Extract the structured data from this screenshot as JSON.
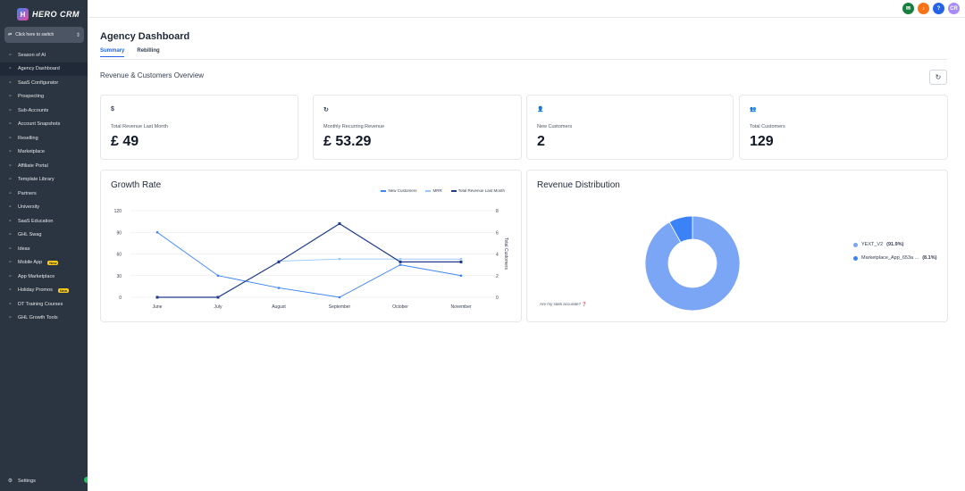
{
  "app": {
    "logo_text": "HERO CRM",
    "switcher_label": "Click here to switch"
  },
  "sidebar": {
    "items": [
      {
        "label": "Season of AI",
        "icon": "sparkle-icon"
      },
      {
        "label": "Agency Dashboard",
        "icon": "dashboard-icon",
        "active": true
      },
      {
        "label": "SaaS Configurator",
        "icon": "sliders-icon"
      },
      {
        "label": "Prospecting",
        "icon": "target-icon"
      },
      {
        "label": "Sub-Accounts",
        "icon": "users-icon"
      },
      {
        "label": "Account Snapshots",
        "icon": "camera-icon"
      },
      {
        "label": "Reselling",
        "icon": "cart-icon"
      },
      {
        "label": "Marketplace",
        "icon": "store-icon"
      },
      {
        "label": "Affiliate Portal",
        "icon": "people-icon"
      },
      {
        "label": "Template Library",
        "icon": "library-icon"
      },
      {
        "label": "Partners",
        "icon": "handshake-icon"
      },
      {
        "label": "University",
        "icon": "graduation-icon"
      },
      {
        "label": "SaaS Education",
        "icon": "education-icon"
      },
      {
        "label": "GHL Swag",
        "icon": "shirt-icon"
      },
      {
        "label": "Ideas",
        "icon": "lightbulb-icon"
      },
      {
        "label": "Mobile App",
        "icon": "mobile-icon",
        "badge": "New"
      },
      {
        "label": "App Marketplace",
        "icon": "apps-icon"
      },
      {
        "label": "Holiday Promos",
        "icon": "gift-icon",
        "badge": "New"
      },
      {
        "label": "DT Training Courses",
        "icon": "play-icon"
      },
      {
        "label": "GHL Growth Tools",
        "icon": "growth-icon"
      }
    ],
    "settings_label": "Settings"
  },
  "topbar": {
    "avatar_initials": "CR"
  },
  "page": {
    "title": "Agency Dashboard",
    "tabs": [
      "Summary",
      "Rebilling"
    ],
    "section_title": "Revenue & Customers Overview"
  },
  "kpis": [
    {
      "icon": "$",
      "label": "Total Revenue Last Month",
      "value": "£ 49"
    },
    {
      "icon": "↻",
      "label": "Monthly Recurring Revenue",
      "value": "£ 53.29"
    },
    {
      "icon": "👤",
      "label": "New Customers",
      "value": "2"
    },
    {
      "icon": "👥",
      "label": "Total Customers",
      "value": "129"
    }
  ],
  "growth": {
    "title": "Growth Rate",
    "right_axis_label": "Total Customers",
    "colors": {
      "new_customers": "#3b82f6",
      "mrr": "#93c5fd",
      "total_revenue": "#1e3a8a"
    }
  },
  "distribution": {
    "title": "Revenue Distribution",
    "stats_note": "Are my stats accurate?",
    "legend": [
      {
        "name": "YEXT_V2",
        "pct": "(91.9%)",
        "color": "#7ba6f5"
      },
      {
        "name": "Marketplace_App_653a ...",
        "pct": "(8.1%)",
        "color": "#3b82f6"
      }
    ]
  },
  "chart_data": [
    {
      "type": "line",
      "title": "Growth Rate",
      "categories": [
        "June",
        "July",
        "August",
        "September",
        "October",
        "November"
      ],
      "y_left_ticks": [
        0,
        30,
        60,
        90,
        120
      ],
      "y_right_ticks": [
        0,
        2,
        4,
        6,
        8
      ],
      "ylabel_right": "Total Customers",
      "ylim": [
        0,
        120
      ],
      "ylim_right": [
        0,
        8
      ],
      "legend_position": "top-right",
      "series": [
        {
          "name": "New Customers",
          "axis": "left",
          "values": [
            90,
            30,
            13,
            0,
            45,
            30
          ]
        },
        {
          "name": "MRR",
          "axis": "left",
          "values": [
            null,
            null,
            50,
            53,
            53,
            53
          ]
        },
        {
          "name": "Total Revenue Last Month",
          "axis": "left",
          "values": [
            0,
            0,
            49,
            102,
            49,
            49
          ]
        }
      ]
    },
    {
      "type": "pie",
      "title": "Revenue Distribution",
      "labels": [
        "YEXT_V2",
        "Marketplace_App_653a ..."
      ],
      "values": [
        91.9,
        8.1
      ]
    }
  ]
}
